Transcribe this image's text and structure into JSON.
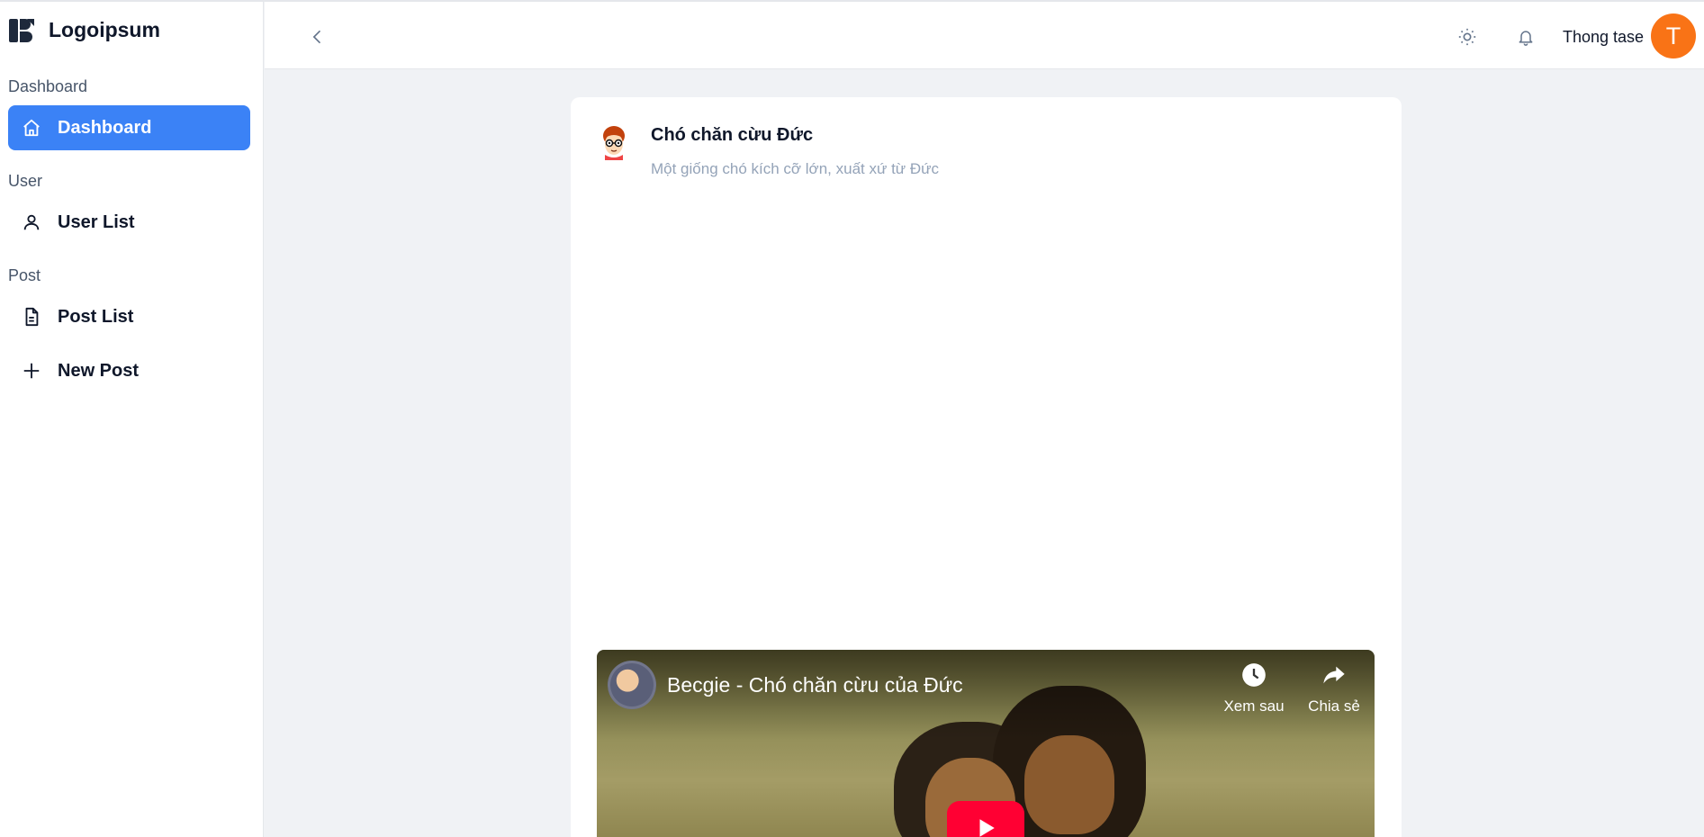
{
  "app": {
    "brand": "Logoipsum"
  },
  "sidebar": {
    "sections": [
      {
        "label": "Dashboard",
        "items": [
          {
            "label": "Dashboard",
            "icon": "home-icon",
            "active": true
          }
        ]
      },
      {
        "label": "User",
        "items": [
          {
            "label": "User List",
            "icon": "user-icon"
          }
        ]
      },
      {
        "label": "Post",
        "items": [
          {
            "label": "Post List",
            "icon": "document-icon"
          },
          {
            "label": "New Post",
            "icon": "plus-icon"
          }
        ]
      }
    ]
  },
  "header": {
    "user_name": "Thong tase",
    "avatar_initial": "T",
    "icons": [
      "chevron-left-icon",
      "sun-icon",
      "bell-icon"
    ]
  },
  "post": {
    "title": "Chó chăn cừu Đức",
    "description": "Một giống chó kích cỡ lớn, xuất xứ từ Đức"
  },
  "video": {
    "title": "Becgie - Chó chăn cừu của Đức",
    "watch_later": "Xem sau",
    "share": "Chia sẻ"
  },
  "colors": {
    "accent": "#3b82f6",
    "avatar": "#f97316",
    "play": "#ff0033"
  }
}
